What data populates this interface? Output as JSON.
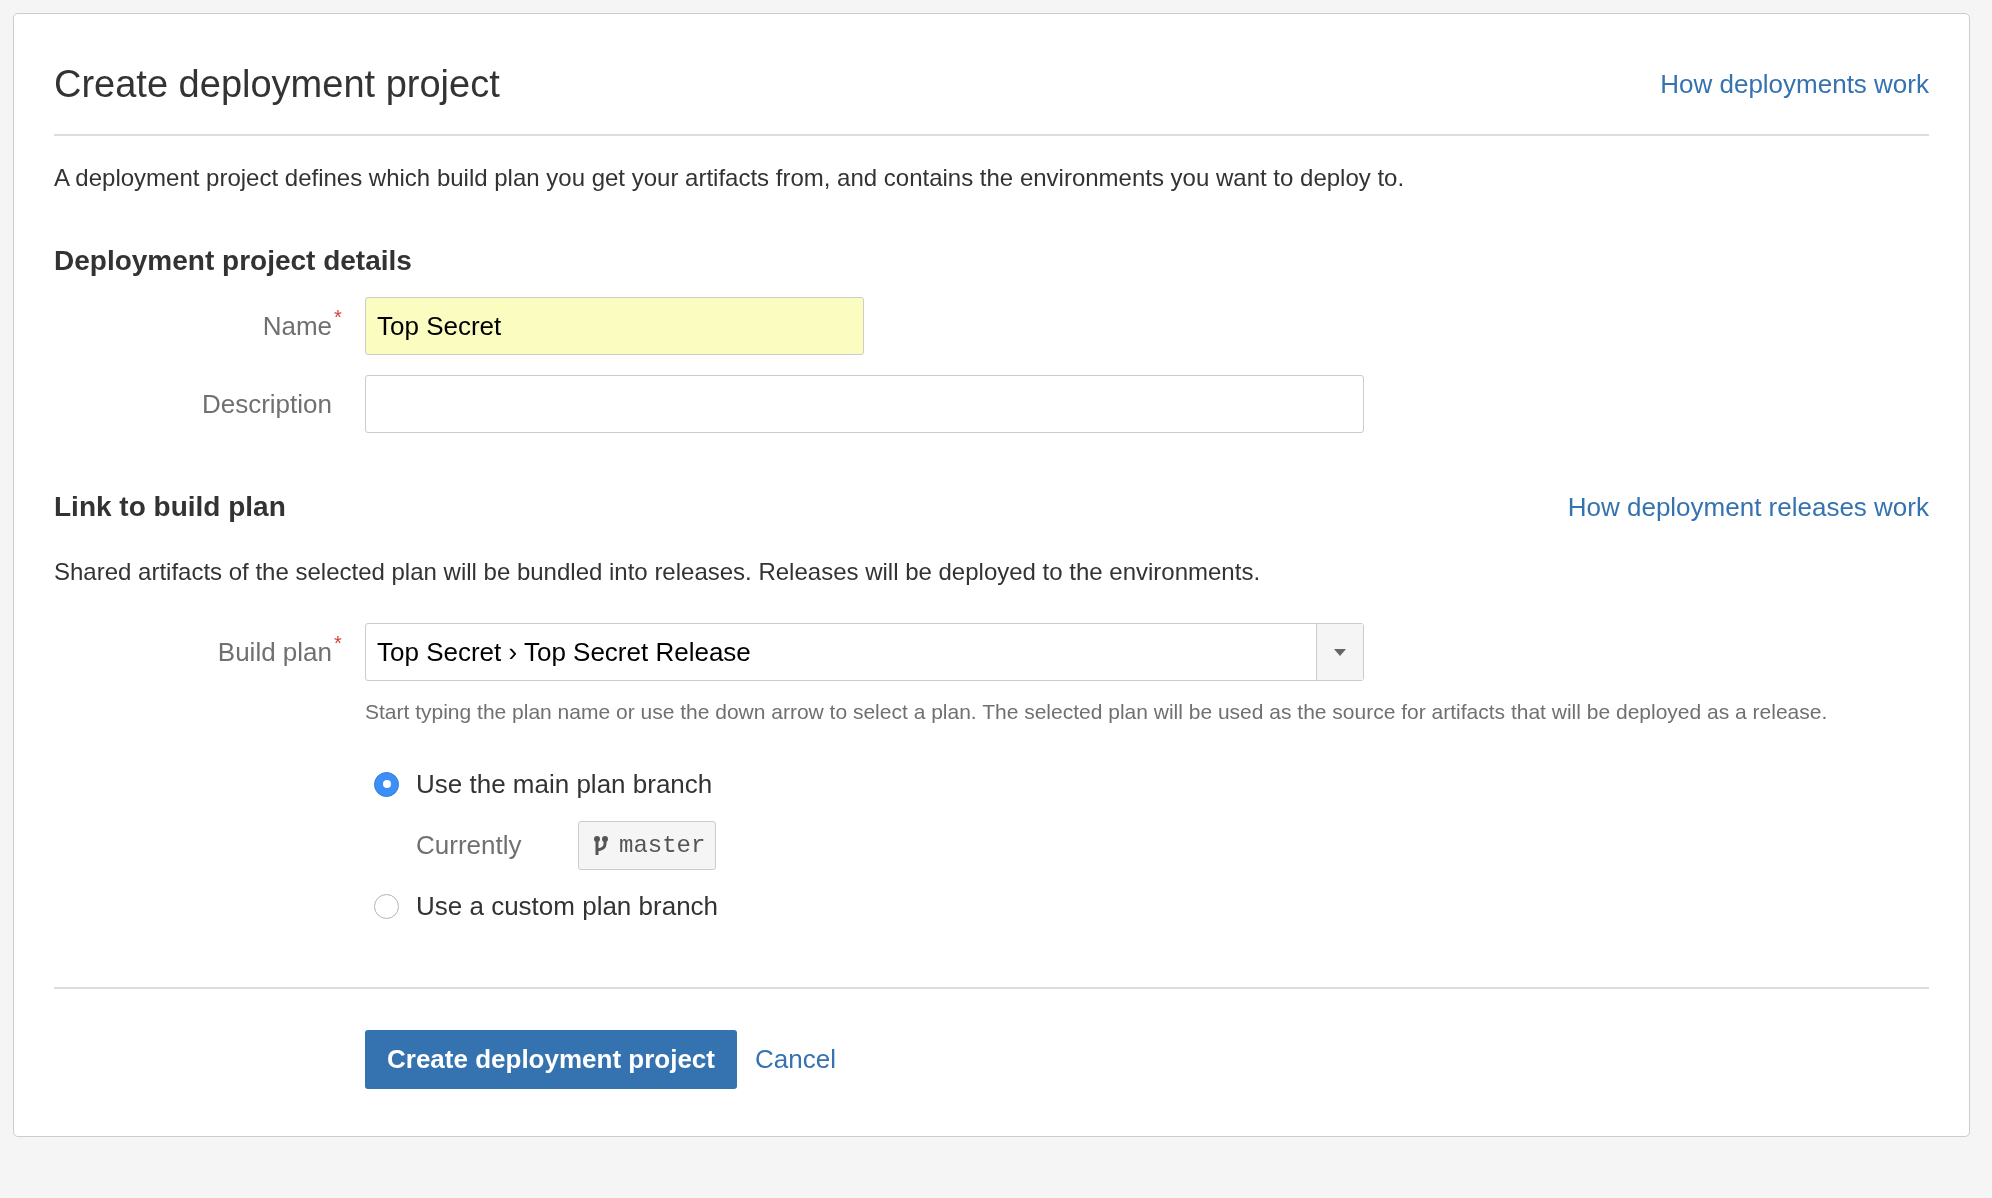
{
  "title": "Create deployment project",
  "help_link": "How deployments work",
  "intro": "A deployment project defines which build plan you get your artifacts from, and contains the environments you want to deploy to.",
  "details": {
    "heading": "Deployment project details",
    "fields": [
      {
        "label": "Name",
        "marker": "*",
        "value": "Top Secret",
        "autofilled": true
      },
      {
        "label": "Description",
        "autofilled": false
      }
    ]
  },
  "link": {
    "heading": "Link to build plan",
    "help_link": "How deployment releases work",
    "description": "Shared artifacts of the selected plan will be bundled into releases. Releases will be deployed to the environments.",
    "build_plan": {
      "label": "Build plan",
      "marker": "*",
      "value": "Top Secret › Top Secret Release",
      "help": "Start typing the plan name or use the down arrow to select a plan. The selected plan will be used as the source for artifacts that will be deployed as a release."
    },
    "branch_options": [
      {
        "label": "Use the main plan branch",
        "selected": true,
        "current_label": "Currently",
        "current_branch": "master"
      },
      {
        "label": "Use a custom plan branch",
        "selected": false
      }
    ]
  },
  "buttons": [
    {
      "kind": "primary",
      "label": "Create deployment project"
    },
    {
      "kind": "link",
      "label": "Cancel"
    }
  ]
}
